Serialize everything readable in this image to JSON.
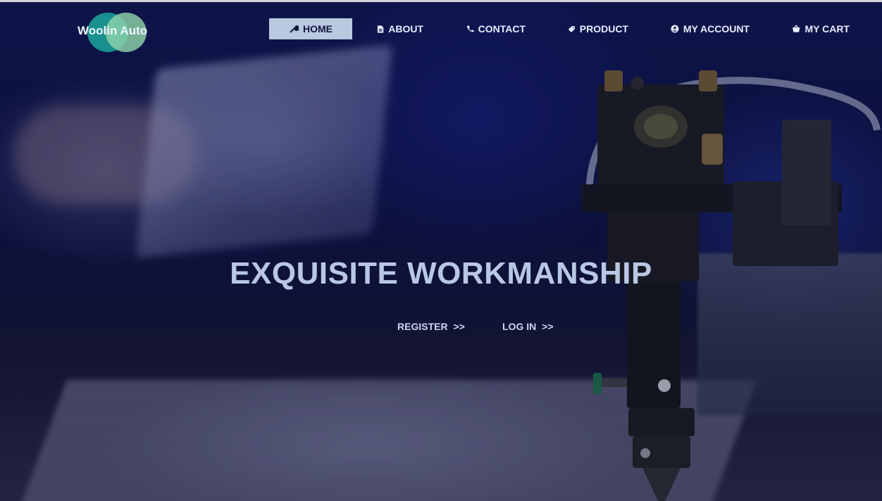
{
  "brand": {
    "name": "Woolin Auto"
  },
  "nav": {
    "items": [
      {
        "label": "HOME",
        "icon": "wrench-icon",
        "active": true
      },
      {
        "label": "ABOUT",
        "icon": "document-icon",
        "active": false
      },
      {
        "label": "CONTACT",
        "icon": "phone-icon",
        "active": false
      },
      {
        "label": "PRODUCT",
        "icon": "tag-icon",
        "active": false
      },
      {
        "label": "MY ACCOUNT",
        "icon": "user-icon",
        "active": false
      },
      {
        "label": "MY CART",
        "icon": "basket-icon",
        "active": false
      }
    ]
  },
  "hero": {
    "headline": "EXQUISITE WORKMANSHIP",
    "register": {
      "label": "REGISTER",
      "arrows": ">>"
    },
    "login": {
      "label": "LOG IN",
      "arrows": ">>"
    }
  },
  "colors": {
    "active_nav_bg": "#b9c9e2",
    "headline": "#b8c7e4",
    "logo_teal": "#1a9a95",
    "logo_green": "#8ed3a8"
  }
}
